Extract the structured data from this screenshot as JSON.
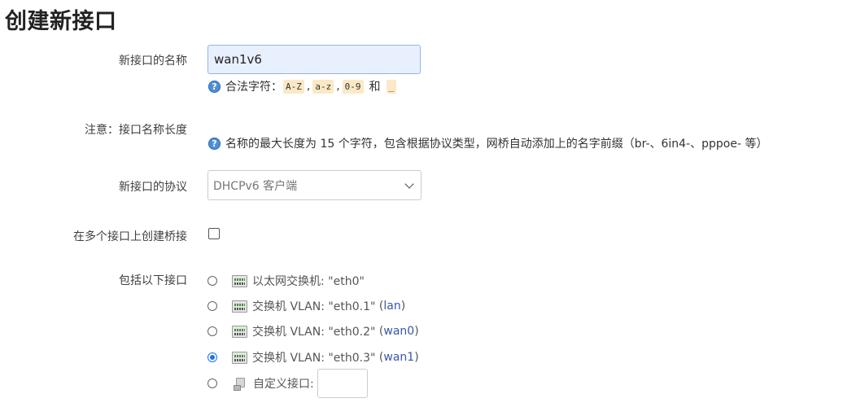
{
  "page": {
    "title": "创建新接口"
  },
  "fields": {
    "name": {
      "label": "新接口的名称",
      "value": "wan1v6",
      "hint_prefix": "合法字符：",
      "allowed": [
        "A-Z",
        "a-z",
        "0-9"
      ],
      "hint_and": "和",
      "underscore": "_"
    },
    "note": {
      "label": "注意：接口名称长度",
      "text": "名称的最大长度为 15 个字符，包含根据协议类型，网桥自动添加上的名字前缀（br-、6in4-、pppoe- 等）"
    },
    "protocol": {
      "label": "新接口的协议",
      "selected": "DHCPv6 客户端"
    },
    "bridge": {
      "label": "在多个接口上创建桥接",
      "checked": false
    },
    "include": {
      "label": "包括以下接口",
      "options": [
        {
          "text": "以太网交换机: \"eth0\"",
          "network": "",
          "checked": false
        },
        {
          "text": "交换机 VLAN: \"eth0.1\"",
          "network": "lan",
          "checked": false
        },
        {
          "text": "交换机 VLAN: \"eth0.2\"",
          "network": "wan0",
          "checked": false
        },
        {
          "text": "交换机 VLAN: \"eth0.3\"",
          "network": "wan1",
          "checked": true
        }
      ],
      "custom_label": "自定义接口:",
      "custom_value": ""
    }
  },
  "icons": {
    "help": "help-icon",
    "switch": "network-switch-icon",
    "custom": "custom-interface-icon"
  }
}
